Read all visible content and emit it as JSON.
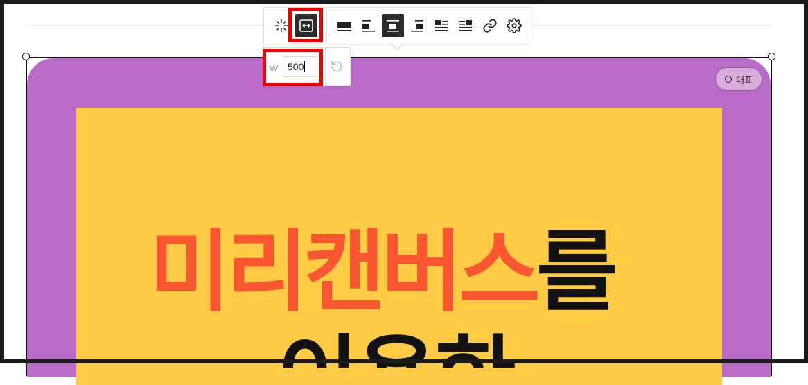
{
  "toolbar": {
    "buttons": [
      {
        "name": "magic-icon",
        "label": "effects"
      },
      {
        "name": "resize-width-icon",
        "label": "resize"
      },
      {
        "name": "align-full-icon",
        "label": "full width"
      },
      {
        "name": "align-left-icon",
        "label": "align left"
      },
      {
        "name": "align-center-icon",
        "label": "align center"
      },
      {
        "name": "align-right-icon",
        "label": "align right"
      },
      {
        "name": "wrap-left-icon",
        "label": "wrap left"
      },
      {
        "name": "wrap-right-icon",
        "label": "wrap right"
      },
      {
        "name": "link-icon",
        "label": "link"
      },
      {
        "name": "gear-icon",
        "label": "settings"
      }
    ],
    "active_buttons": [
      "resize-width-icon",
      "align-center-icon"
    ]
  },
  "width_popover": {
    "label": "W",
    "value": "500",
    "reset_icon": "reset-icon"
  },
  "image": {
    "badge_label": "대표",
    "headline_orange": "미리캔버스",
    "headline_dark": "를",
    "subline": "이용한"
  },
  "colors": {
    "purple": "#b86bc7",
    "yellow": "#ffcb45",
    "orange_text": "#fb5632",
    "highlight_red": "#f20000"
  }
}
